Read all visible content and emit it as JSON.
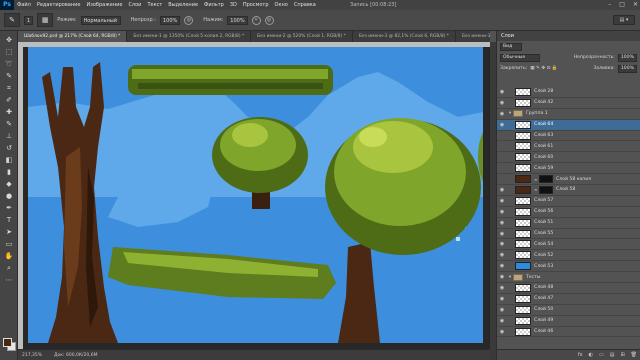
{
  "app": {
    "logo": "Ps",
    "doc_title_right": "Запись [00:08:23]"
  },
  "menu": [
    "Файл",
    "Редактирование",
    "Изображение",
    "Слои",
    "Текст",
    "Выделение",
    "Фильтр",
    "3D",
    "Просмотр",
    "Окно",
    "Справка"
  ],
  "window_controls": [
    "–",
    "□",
    "✕"
  ],
  "options": {
    "mode_label": "Режим:",
    "mode_value": "Нормальный",
    "opacity_label": "Непрозр.:",
    "opacity_value": "100%",
    "flow_label": "Нажим:",
    "flow_value": "100%",
    "brush_size": "1",
    "workspace": "▤ ▾"
  },
  "tabs": [
    "Шаблон92.psd @ 217% (Слой 64, RGB/8) *",
    "Без имени-1 @ 1350% (Слой 5 копия 2, RGB/8) *",
    "Без имени-2 @ 520% (Слой 1, RGB/8) *",
    "Без имени-3 @ 82,1% (Слой 6, RGB/8) *",
    "Без имени-3 @ 0"
  ],
  "status": {
    "zoom": "217,35%",
    "doc": "Док: 600,0К/20,6М"
  },
  "panel": {
    "title": "Слои",
    "kind_label": "Вид",
    "blend_value": "Обычные",
    "opacity_label": "Непрозрачность:",
    "opacity_value": "100%",
    "lock_label": "Закрепить:",
    "fill_label": "Заливка:",
    "fill_value": "100%"
  },
  "layers": [
    {
      "name": "Слой 28",
      "visible": true,
      "kind": "layer"
    },
    {
      "name": "Слой 42",
      "visible": true,
      "kind": "layer"
    },
    {
      "name": "Группа 1",
      "visible": true,
      "kind": "group"
    },
    {
      "name": "Слой 64",
      "visible": true,
      "kind": "layer",
      "selected": true
    },
    {
      "name": "Слой 63",
      "visible": false,
      "kind": "layer"
    },
    {
      "name": "Слой 61",
      "visible": false,
      "kind": "layer"
    },
    {
      "name": "Слой 60",
      "visible": false,
      "kind": "layer"
    },
    {
      "name": "Слой 59",
      "visible": false,
      "kind": "layer"
    },
    {
      "name": "Слой 58 копия",
      "visible": false,
      "kind": "masked",
      "thumb": "#4a2814"
    },
    {
      "name": "Слой 58",
      "visible": true,
      "kind": "masked",
      "thumb": "#4a2814"
    },
    {
      "name": "Слой 57",
      "visible": true,
      "kind": "layer"
    },
    {
      "name": "Слой 56",
      "visible": true,
      "kind": "layer"
    },
    {
      "name": "Слой 51",
      "visible": true,
      "kind": "layer"
    },
    {
      "name": "Слой 55",
      "visible": true,
      "kind": "layer"
    },
    {
      "name": "Слой 54",
      "visible": true,
      "kind": "layer"
    },
    {
      "name": "Слой 52",
      "visible": true,
      "kind": "layer"
    },
    {
      "name": "Слой 53",
      "visible": true,
      "kind": "layer",
      "thumb": "#2d8be0"
    },
    {
      "name": "Тесты",
      "visible": true,
      "kind": "group"
    },
    {
      "name": "Слой 48",
      "visible": true,
      "kind": "layer"
    },
    {
      "name": "Слой 47",
      "visible": true,
      "kind": "layer"
    },
    {
      "name": "Слой 50",
      "visible": true,
      "kind": "layer"
    },
    {
      "name": "Слой 49",
      "visible": true,
      "kind": "layer"
    },
    {
      "name": "Слой 46",
      "visible": true,
      "kind": "layer"
    }
  ],
  "panel_footer": [
    "fx",
    "◐",
    "▭",
    "▤",
    "⊞",
    "🗑"
  ],
  "colors": {
    "sky": "#3d8fde",
    "hills": "#5fa8ea",
    "trunk": "#4a2814",
    "foliage": "#7fa52a"
  }
}
